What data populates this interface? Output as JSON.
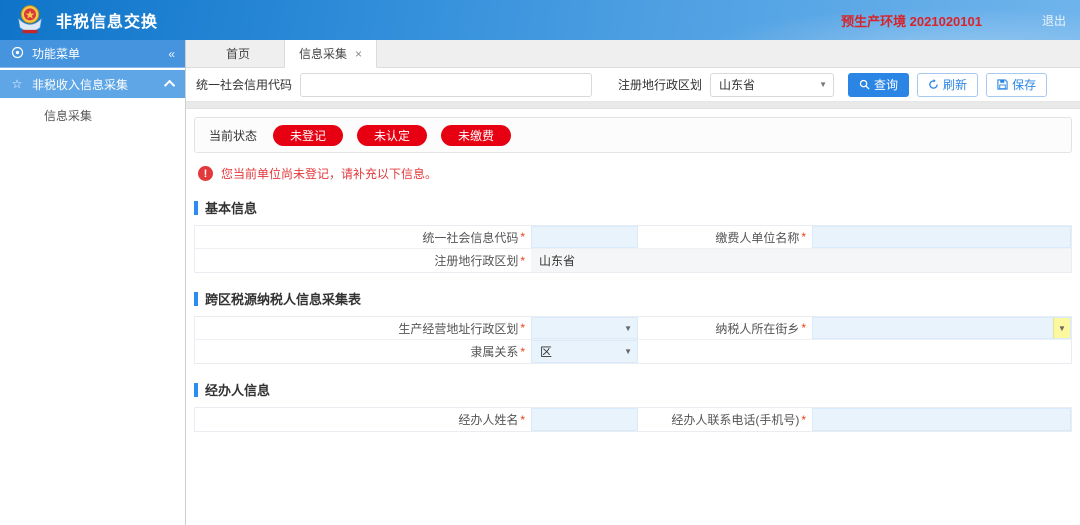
{
  "header": {
    "title": "非税信息交换",
    "env_label": "预生产环境 2021020101",
    "logout_label": "退出"
  },
  "sidebar": {
    "menu_title": "功能菜单",
    "group_label": "非税收入信息采集",
    "item_label": "信息采集"
  },
  "tabs": {
    "home": {
      "label": "首页"
    },
    "collection": {
      "label": "信息采集"
    }
  },
  "toolbar": {
    "credit_code_label": "统一社会信用代码",
    "region_label": "注册地行政区划",
    "region_value": "山东省",
    "query_label": "查询",
    "refresh_label": "刷新",
    "save_label": "保存"
  },
  "status": {
    "label": "当前状态",
    "badges": [
      "未登记",
      "未认定",
      "未缴费"
    ]
  },
  "warning": {
    "message": "您当前单位尚未登记，请补充以下信息。"
  },
  "sections": {
    "basic": {
      "title": "基本信息",
      "credit_code_label": "统一社会信息代码",
      "payer_name_label": "缴费人单位名称",
      "reg_region_label": "注册地行政区划",
      "reg_region_value": "山东省"
    },
    "cross": {
      "title": "跨区税源纳税人信息采集表",
      "biz_region_label": "生产经营地址行政区划",
      "street_label": "纳税人所在街乡",
      "affiliation_label": "隶属关系",
      "affiliation_value": "区"
    },
    "agent": {
      "title": "经办人信息",
      "name_label": "经办人姓名",
      "phone_label": "经办人联系电话(手机号)"
    }
  },
  "icons": {
    "collapse": "«",
    "dropdown": "▼",
    "close": "×",
    "warning_mark": "!",
    "star": "☆",
    "gear": "◎"
  },
  "misc": {
    "required_mark": "*"
  },
  "colors": {
    "header_blue": "#2b8ad8",
    "accent_blue": "#2d8cf0",
    "badge_red": "#e60012",
    "warning_red": "#e4393c",
    "env_red": "#d8232a",
    "field_blue_bg": "#e9f3fc",
    "yellow_highlight": "#fbf8a0"
  }
}
